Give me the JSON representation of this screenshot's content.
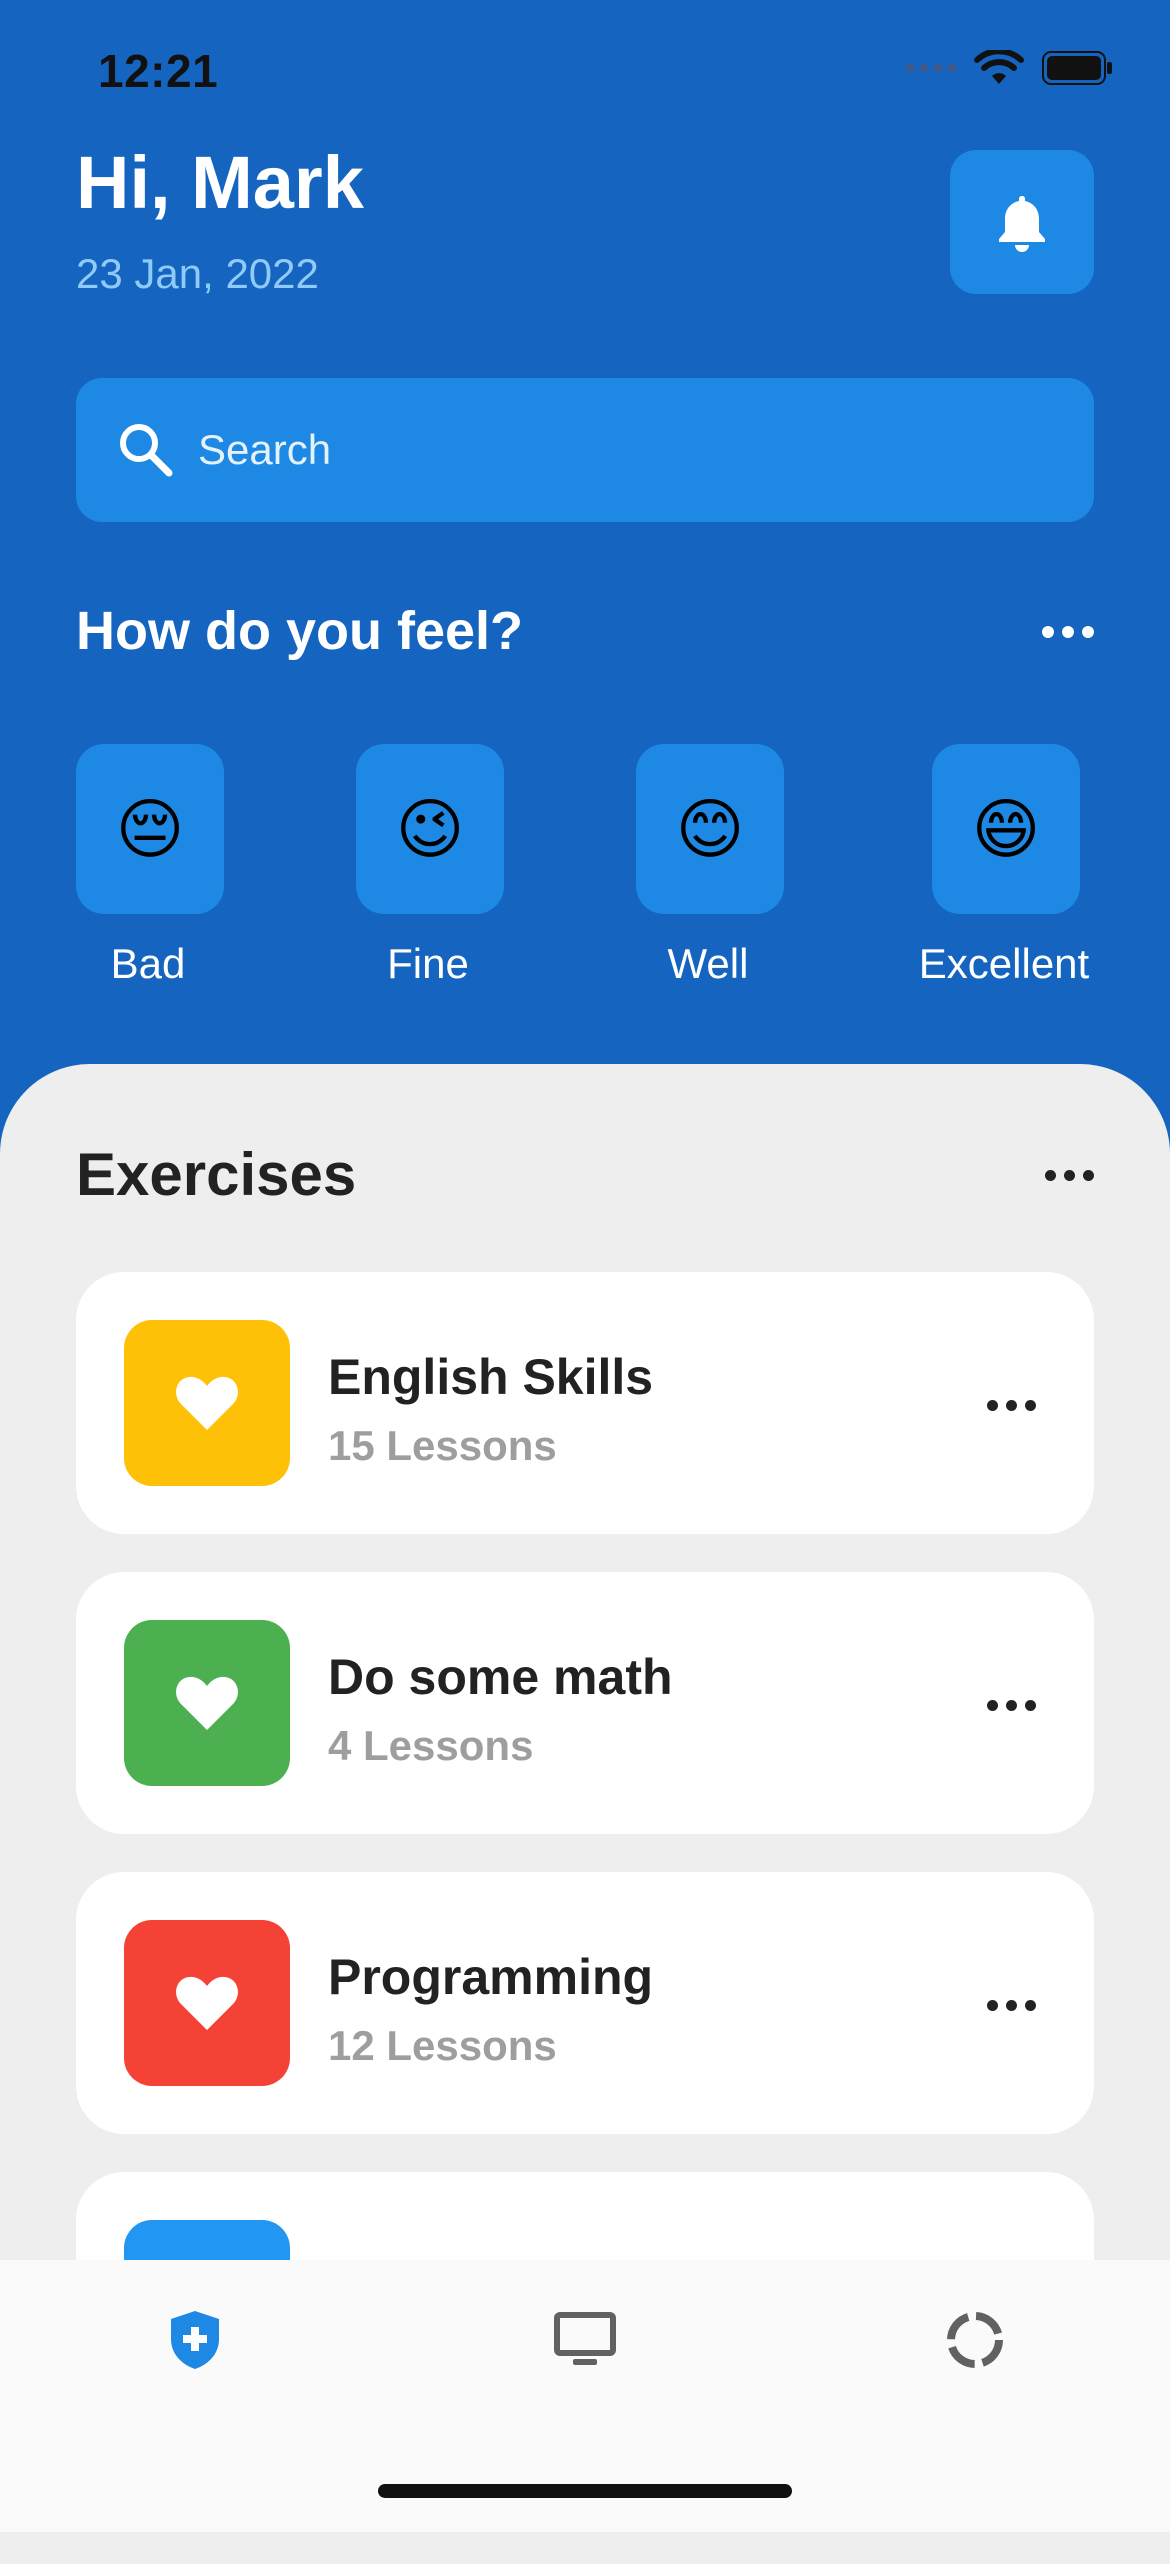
{
  "status_bar": {
    "time": "12:21"
  },
  "header": {
    "greeting": "Hi, Mark",
    "date": "23 Jan, 2022",
    "bell_icon": "bell-icon"
  },
  "search": {
    "placeholder": "Search",
    "value": ""
  },
  "mood": {
    "title": "How do you feel?",
    "options": [
      {
        "emoji": "😔",
        "label": "Bad"
      },
      {
        "emoji": "😉",
        "label": "Fine"
      },
      {
        "emoji": "😊",
        "label": "Well"
      },
      {
        "emoji": "😄",
        "label": "Excellent"
      }
    ]
  },
  "exercises": {
    "title": "Exercises",
    "items": [
      {
        "title": "English Skills",
        "subtitle": "15 Lessons",
        "color": "#FFC107",
        "icon": "heart-icon"
      },
      {
        "title": "Do some math",
        "subtitle": "4 Lessons",
        "color": "#4CAF50",
        "icon": "heart-icon"
      },
      {
        "title": "Programming",
        "subtitle": "12 Lessons",
        "color": "#F44336",
        "icon": "heart-icon"
      }
    ]
  },
  "tabbar": {
    "active_color": "#1E88E5",
    "tabs": [
      {
        "icon": "shield-plus-icon",
        "active": true
      },
      {
        "icon": "monitor-icon",
        "active": false
      },
      {
        "icon": "progress-ring-icon",
        "active": false
      }
    ]
  },
  "colors": {
    "primary": "#1565C0",
    "accent": "#1E88E5",
    "sheet": "#EEEEEE"
  }
}
